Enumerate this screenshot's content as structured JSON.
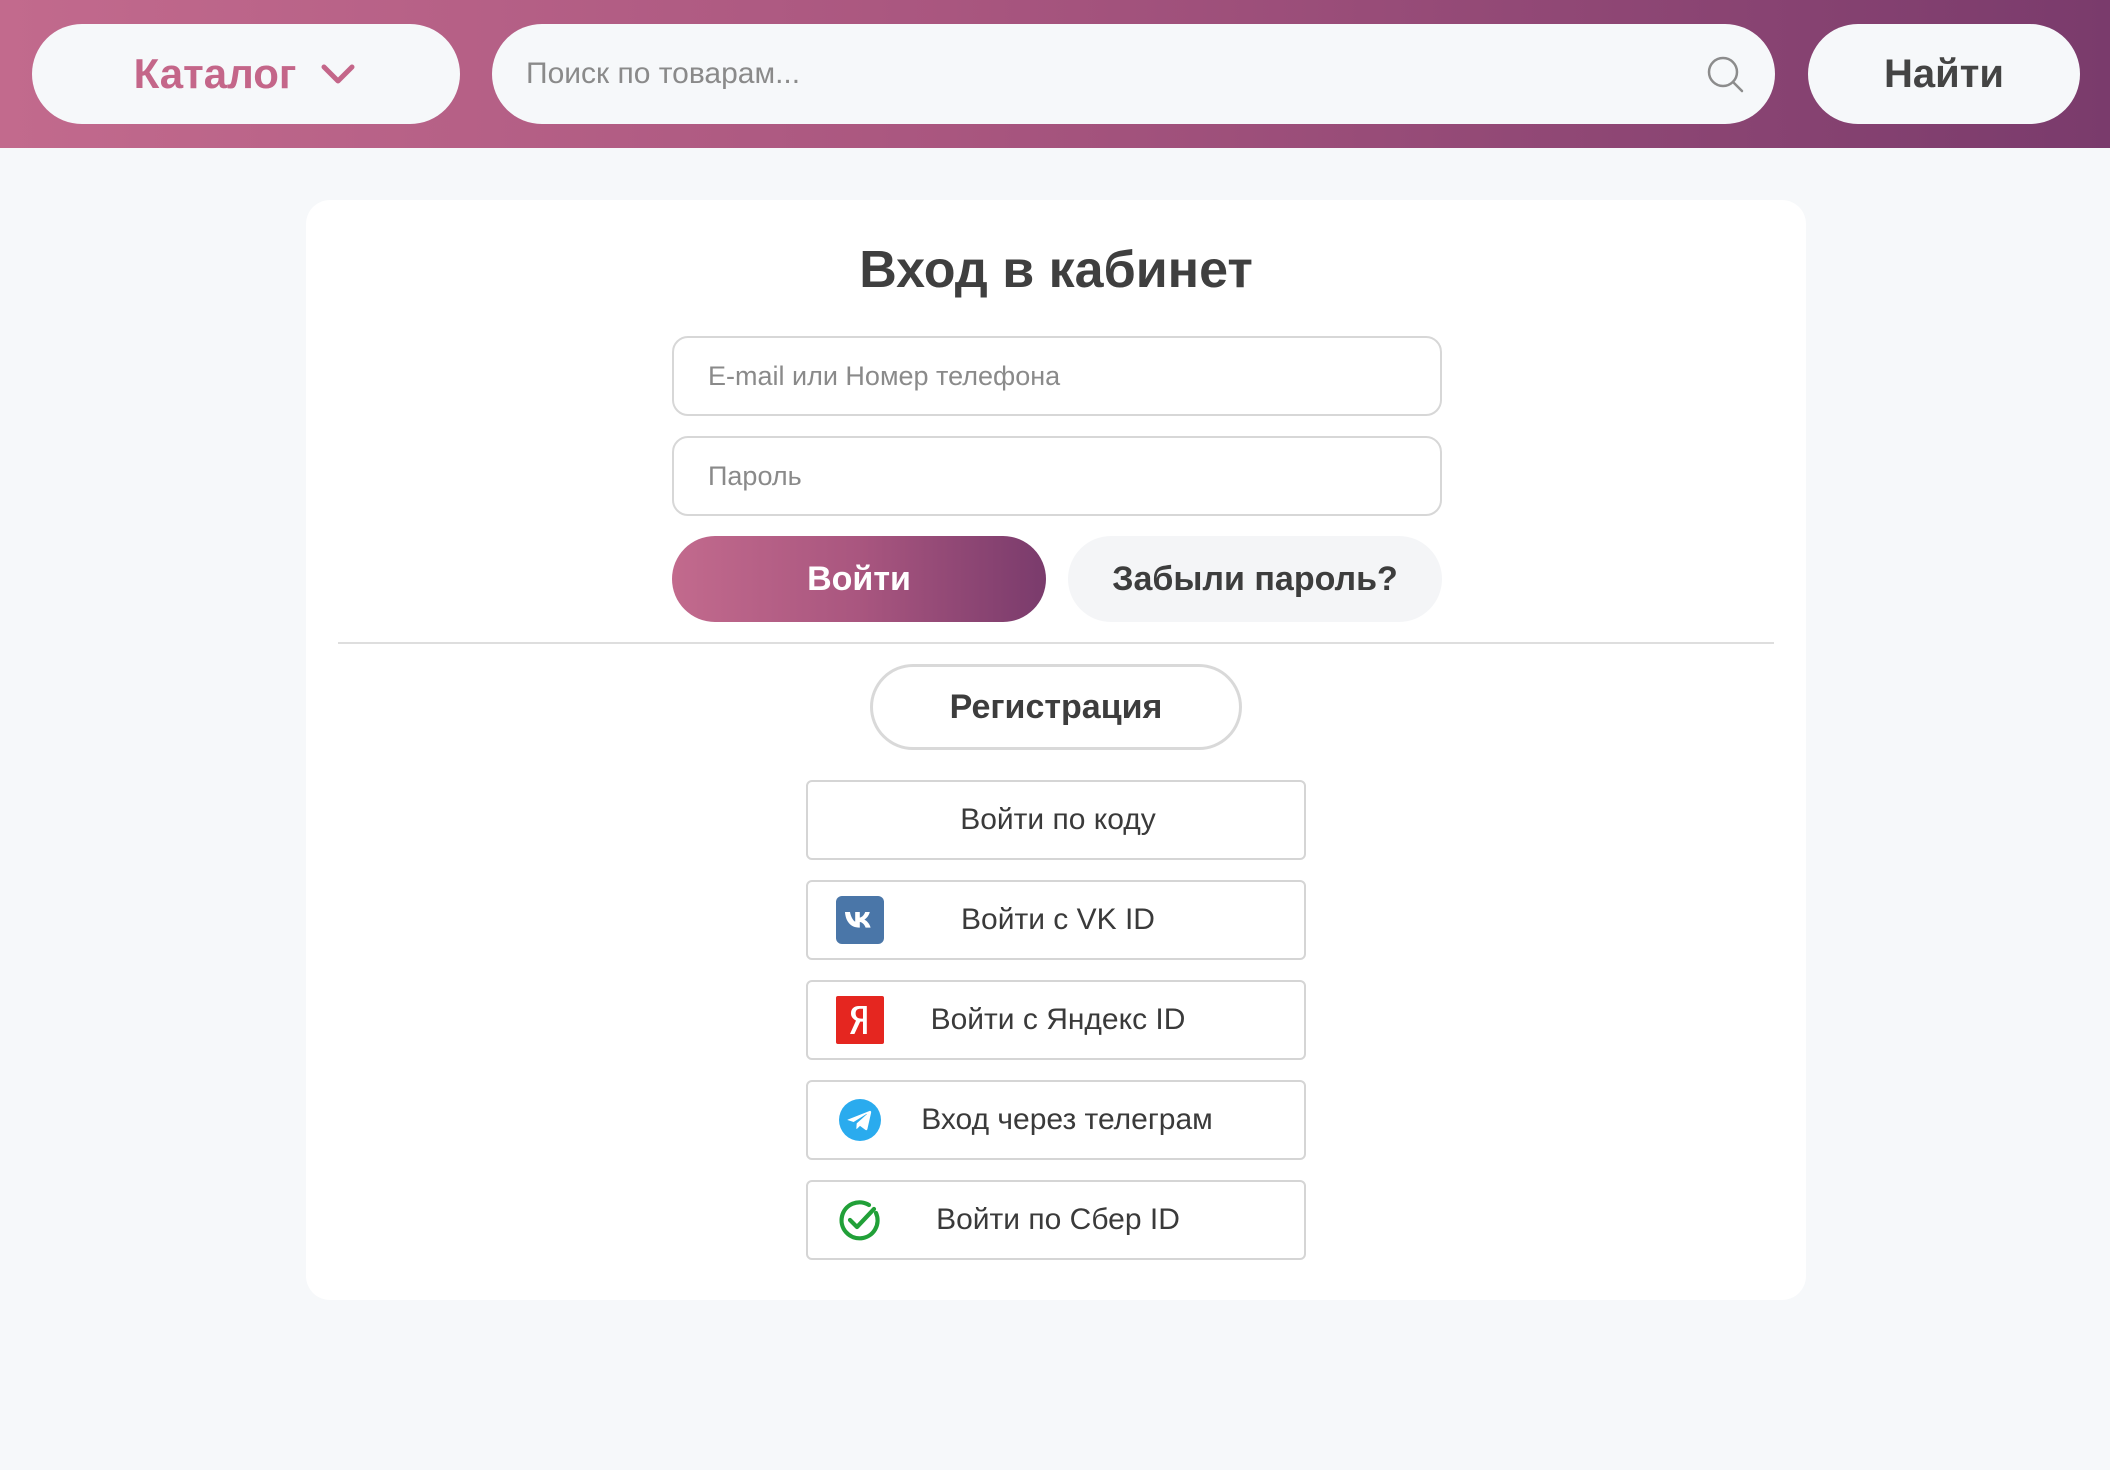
{
  "header": {
    "catalog_label": "Каталог",
    "search_placeholder": "Поиск по товарам...",
    "find_label": "Найти",
    "gradient_colors": [
      "#c26a8d",
      "#7a3b6c"
    ],
    "catalog_text_color": "#c46689"
  },
  "login": {
    "title": "Вход в кабинет",
    "email_placeholder": "E-mail или Номер телефона",
    "password_placeholder": "Пароль",
    "submit_label": "Войти",
    "forgot_label": "Забыли пароль?",
    "register_label": "Регистрация"
  },
  "alt_logins": [
    {
      "label": "Войти по коду",
      "icon": ""
    },
    {
      "label": "Войти с VK ID",
      "icon": "vk-icon",
      "color": "#4a76a8"
    },
    {
      "label": "Войти с Яндекс ID",
      "icon": "yandex-icon",
      "color": "#e52620"
    },
    {
      "label": "Вход через телеграм",
      "icon": "telegram-icon",
      "color": "#2aabee"
    },
    {
      "label": "Войти по Сбер ID",
      "icon": "sber-icon",
      "color": "#21a038"
    }
  ]
}
